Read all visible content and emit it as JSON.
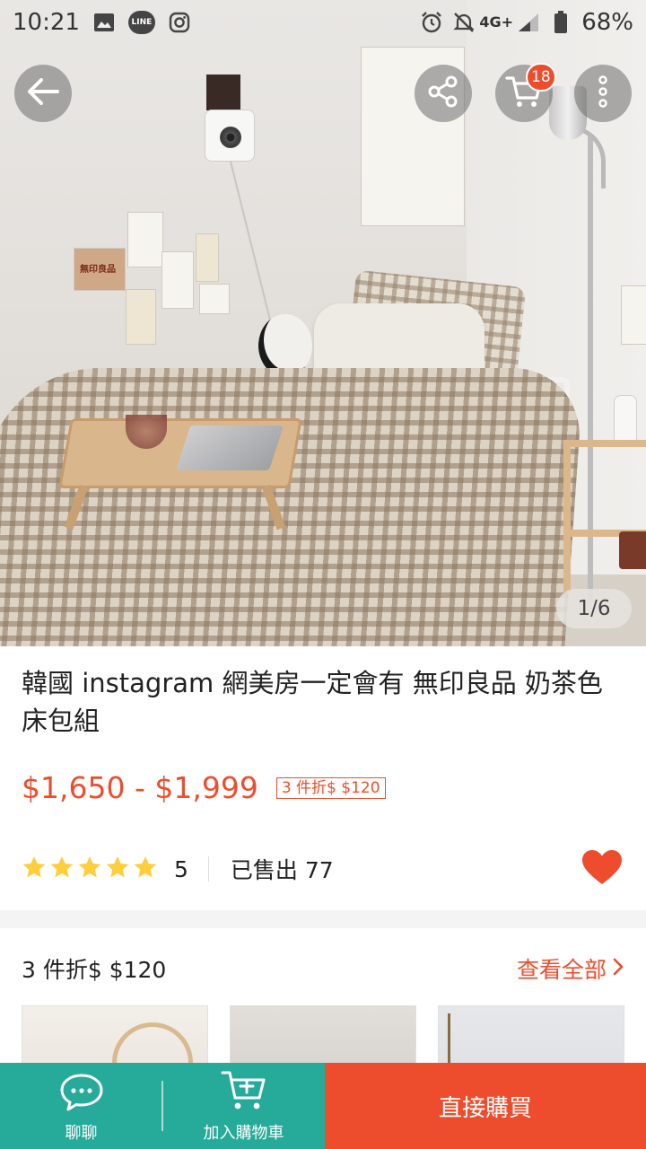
{
  "status_bar": {
    "time": "10:21",
    "notification_icons": [
      "image-icon",
      "line-app-icon",
      "instagram-icon"
    ],
    "line_label": "LINE",
    "network": "4G+",
    "battery": "68%"
  },
  "header": {
    "back_icon": "arrow-left-icon",
    "share_icon": "share-icon",
    "cart_icon": "cart-icon",
    "cart_badge": "18",
    "more_icon": "more-vertical-icon"
  },
  "gallery": {
    "photo_text": "無印良品",
    "pager": "1/6"
  },
  "product": {
    "title": "韓國 instagram 網美房一定會有 無印良品 奶茶色 床包組",
    "price": "$1,650 - $1,999",
    "promo_tag": "3 件折$ $120",
    "rating_stars": 5,
    "rating_count": "5",
    "sold": "已售出 77",
    "liked": true
  },
  "bundle": {
    "title": "3 件折$ $120",
    "see_all": "查看全部"
  },
  "bottom_bar": {
    "chat_label": "聊聊",
    "add_to_cart_label": "加入購物車",
    "buy_now_label": "直接購買"
  },
  "colors": {
    "accent": "#ee4d2d",
    "teal": "#26aa99",
    "star": "#ffce3d"
  }
}
